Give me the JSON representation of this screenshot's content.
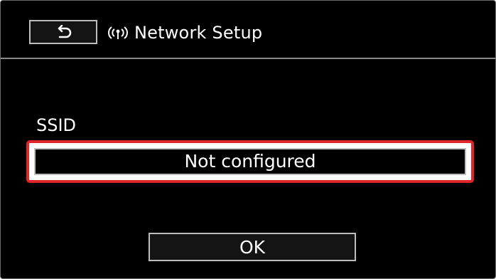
{
  "header": {
    "back_icon": "return-arrow-icon",
    "wifi_icon": "wifi-antenna-icon",
    "title": "Network Setup"
  },
  "form": {
    "ssid_label": "SSID",
    "ssid_value": "Not configured"
  },
  "actions": {
    "ok_label": "OK"
  },
  "colors": {
    "highlight": "#e0262a",
    "background": "#000000",
    "button_border": "#bdbdbd"
  }
}
